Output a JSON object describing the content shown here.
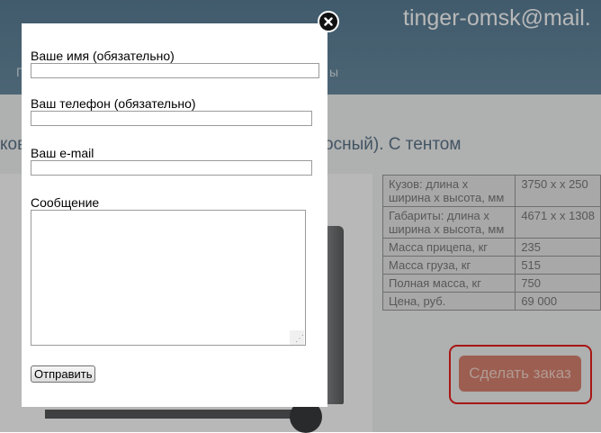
{
  "header": {
    "email": "tinger-omsk@mail.",
    "nav_left": "П",
    "nav_right": "ы"
  },
  "product": {
    "title_left": "ков",
    "title_right": "ноосный). С тентом"
  },
  "specs": [
    {
      "label": "Кузов: длина х ширина х высота, мм",
      "value": "3750 х х 250"
    },
    {
      "label": "Габариты: длина х ширина х высота, мм",
      "value": "4671 х х 1308"
    },
    {
      "label": "Масса прицепа, кг",
      "value": "235"
    },
    {
      "label": "Масса груза, кг",
      "value": "515"
    },
    {
      "label": "Полная масса, кг",
      "value": "750"
    },
    {
      "label": "Цена, руб.",
      "value": "69 000"
    }
  ],
  "order_button": "Сделать заказ",
  "form": {
    "name_label": "Ваше имя (обязательно)",
    "phone_label": "Ваш телефон (обязательно)",
    "email_label": "Ваш e-mail",
    "message_label": "Сообщение",
    "submit_label": "Отправить",
    "close_icon": "close-icon"
  },
  "colors": {
    "header": "#5a7f97",
    "accent_red": "#e8201c",
    "order_button": "#d9836f"
  }
}
